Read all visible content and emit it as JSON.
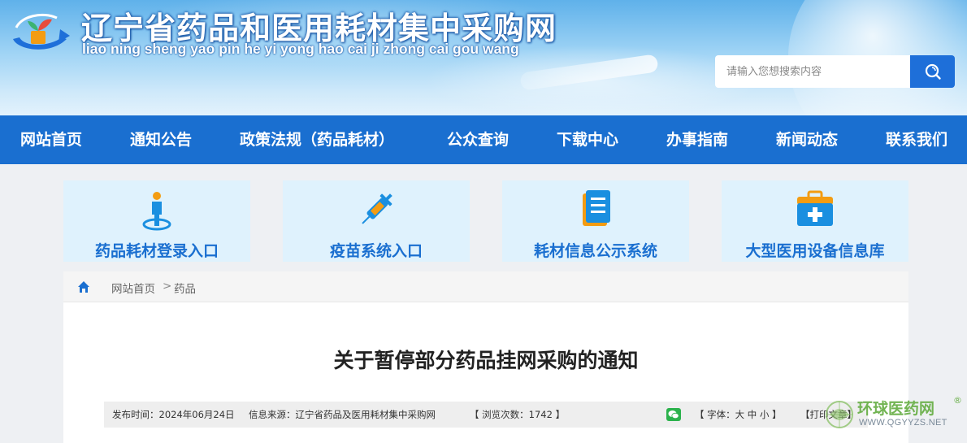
{
  "header": {
    "title": "辽宁省药品和医用耗材集中采购网",
    "pinyin": "liao ning sheng yao pin he yi yong hao cai ji zhong cai gou wang",
    "logo_icon": "plant-arrow-logo-icon"
  },
  "search": {
    "placeholder": "请输入您想搜索内容",
    "value": "",
    "icon": "search-icon"
  },
  "nav": {
    "items": [
      {
        "label": "网站首页"
      },
      {
        "label": "通知公告"
      },
      {
        "label": "政策法规（药品耗材）"
      },
      {
        "label": "公众查询"
      },
      {
        "label": "下载中心"
      },
      {
        "label": "办事指南"
      },
      {
        "label": "新闻动态"
      },
      {
        "label": "联系我们"
      }
    ]
  },
  "cards": [
    {
      "label": "药品耗材登录入口",
      "icon": "person-pin-icon"
    },
    {
      "label": "疫苗系统入口",
      "icon": "syringe-icon"
    },
    {
      "label": "耗材信息公示系统",
      "icon": "document-list-icon"
    },
    {
      "label": "大型医用设备信息库",
      "icon": "medical-kit-icon"
    }
  ],
  "breadcrumb": {
    "home": "网站首页",
    "separator": ">",
    "current": "药品"
  },
  "article": {
    "title": "关于暂停部分药品挂网采购的通知"
  },
  "meta": {
    "publish_time": "发布时间：2024年06月24日",
    "source": "信息来源：辽宁省药品及医用耗材集中采购网",
    "views": "【 浏览次数：1742 】",
    "font_size": "【 字体：大 中 小 】",
    "print": "【打印文章】"
  },
  "watermark": {
    "name": "环球医药网",
    "reg": "®",
    "url": "WWW.QGYYZS.NET"
  },
  "colors": {
    "nav_bg": "#1a6fd0",
    "card_bg": "#dff2fd",
    "card_text": "#1a6fd0",
    "watermark_green": "#6bb04a"
  }
}
